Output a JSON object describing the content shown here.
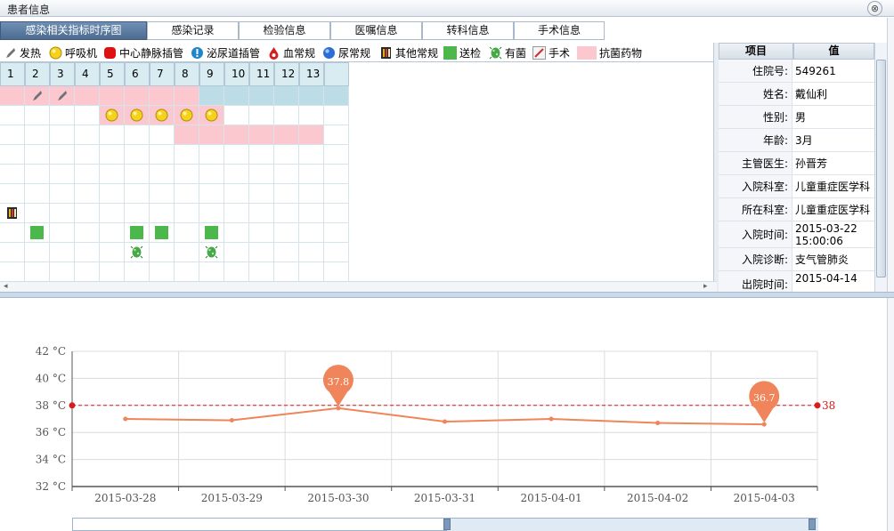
{
  "window": {
    "title": "患者信息",
    "close_label": "⊗"
  },
  "tabs": [
    {
      "label": "感染相关指标时序图",
      "active": true
    },
    {
      "label": "感染记录"
    },
    {
      "label": "检验信息"
    },
    {
      "label": "医嘱信息"
    },
    {
      "label": "转科信息"
    },
    {
      "label": "手术信息"
    }
  ],
  "legend": [
    {
      "label": "发热",
      "icon": "fever-icon"
    },
    {
      "label": "呼吸机",
      "icon": "ventilator-icon"
    },
    {
      "label": "中心静脉插管",
      "icon": "central-venous-catheter-icon"
    },
    {
      "label": "泌尿道插管",
      "icon": "urinary-catheter-icon"
    },
    {
      "label": "血常规",
      "icon": "blood-routine-icon"
    },
    {
      "label": "尿常规",
      "icon": "urine-routine-icon"
    },
    {
      "label": "其他常规",
      "icon": "other-routine-icon"
    },
    {
      "label": "送检",
      "icon": "specimen-sent-icon"
    },
    {
      "label": "有菌",
      "icon": "bacteria-icon"
    },
    {
      "label": "手术",
      "icon": "surgery-icon"
    },
    {
      "label": "抗菌药物",
      "icon": "antibiotic-icon"
    }
  ],
  "grid": {
    "day_headers": [
      "1",
      "2",
      "3",
      "4",
      "5",
      "6",
      "7",
      "8",
      "9",
      "10",
      "11",
      "12",
      "13"
    ],
    "rows": [
      {
        "bg": "pink-1-8",
        "icons": [
          {
            "day": 2,
            "type": "fever"
          },
          {
            "day": 3,
            "type": "fever"
          }
        ]
      },
      {
        "bg": "pink-5-9",
        "icons": [
          {
            "day": 5,
            "type": "ventilator"
          },
          {
            "day": 6,
            "type": "ventilator"
          },
          {
            "day": 7,
            "type": "ventilator"
          },
          {
            "day": 8,
            "type": "ventilator"
          },
          {
            "day": 9,
            "type": "ventilator"
          }
        ]
      },
      {
        "bg": "pink-8-13",
        "icons": []
      },
      {
        "bg": "none",
        "icons": []
      },
      {
        "bg": "none",
        "icons": []
      },
      {
        "bg": "none",
        "icons": []
      },
      {
        "bg": "none",
        "icons": [
          {
            "day": 1,
            "type": "other-routine"
          }
        ]
      },
      {
        "bg": "none",
        "icons": [
          {
            "day": 2,
            "type": "specimen"
          },
          {
            "day": 6,
            "type": "specimen"
          },
          {
            "day": 7,
            "type": "specimen"
          },
          {
            "day": 9,
            "type": "specimen"
          }
        ]
      },
      {
        "bg": "none",
        "icons": [
          {
            "day": 6,
            "type": "bacteria"
          },
          {
            "day": 9,
            "type": "bacteria"
          }
        ]
      },
      {
        "bg": "none",
        "icons": []
      }
    ]
  },
  "patient_info": {
    "header_item": "项目",
    "header_value": "值",
    "rows": [
      {
        "key": "住院号:",
        "value": "549261"
      },
      {
        "key": "姓名:",
        "value": "戴仙利"
      },
      {
        "key": "性别:",
        "value": "男"
      },
      {
        "key": "年龄:",
        "value": "3月"
      },
      {
        "key": "主管医生:",
        "value": "孙晋芳"
      },
      {
        "key": "入院科室:",
        "value": "儿童重症医学科"
      },
      {
        "key": "所在科室:",
        "value": "儿童重症医学科"
      },
      {
        "key": "入院时间:",
        "value": "2015-03-22 15:00:06"
      },
      {
        "key": "入院诊断:",
        "value": "支气管肺炎"
      },
      {
        "key": "出院时间:",
        "value": "2015-04-14"
      }
    ]
  },
  "chart_data": {
    "type": "line",
    "x": [
      "2015-03-28",
      "2015-03-29",
      "2015-03-30",
      "2015-03-31",
      "2015-04-01",
      "2015-04-02",
      "2015-04-03"
    ],
    "series": [
      {
        "values": [
          37.0,
          36.9,
          37.8,
          36.8,
          37.0,
          36.7,
          36.6
        ],
        "color": "#f0845a"
      }
    ],
    "ylim": [
      32,
      42
    ],
    "yticks": [
      "32 °C",
      "34 °C",
      "36 °C",
      "38 °C",
      "40 °C",
      "42 °C"
    ],
    "markline": {
      "value": 38,
      "label": "38",
      "color": "#d81b1b"
    },
    "markpoints": [
      {
        "x": "2015-03-30",
        "value": 37.8,
        "label": "37.8"
      },
      {
        "x": "2015-04-03",
        "value": 36.6,
        "label": "36.7"
      }
    ],
    "grid": true
  }
}
